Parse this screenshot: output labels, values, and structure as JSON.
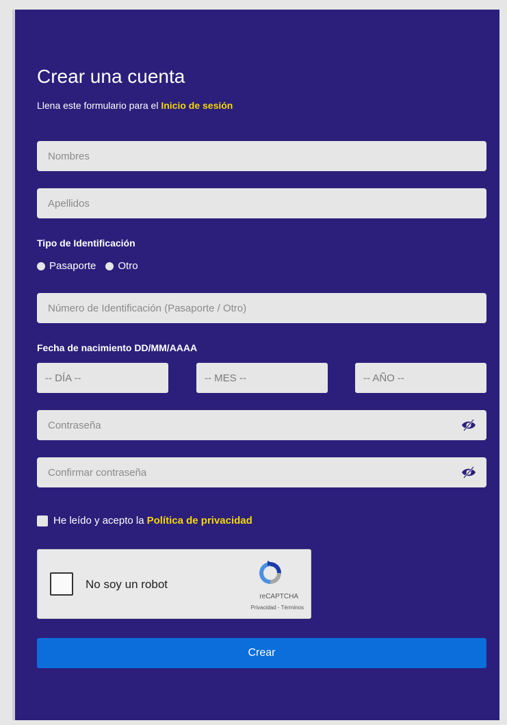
{
  "form": {
    "title": "Crear una cuenta",
    "subtitle_prefix": "Llena este formulario para el ",
    "subtitle_link": "Inicio de sesión",
    "first_name_placeholder": "Nombres",
    "last_name_placeholder": "Apellidos",
    "id_type_label": "Tipo de Identificación",
    "id_type_options": [
      "Pasaporte",
      "Otro"
    ],
    "id_number_placeholder": "Número de Identificación (Pasaporte / Otro)",
    "birthdate_label": "Fecha de nacimiento DD/MM/AAAA",
    "day_placeholder": "-- DÍA --",
    "month_placeholder": "-- MES --",
    "year_placeholder": "-- AÑO --",
    "password_placeholder": "Contraseña",
    "confirm_password_placeholder": "Confirmar contraseña",
    "privacy_prefix": "He leído y acepto la ",
    "privacy_link": "Política de privacidad",
    "submit_label": "Crear"
  },
  "captcha": {
    "label": "No soy un robot",
    "brand": "reCAPTCHA",
    "links": "Privacidad - Términos"
  },
  "colors": {
    "panel_bg": "#2b1f7b",
    "accent_yellow": "#f5d60a",
    "button_blue": "#0b6edb",
    "field_bg": "#e6e6e6"
  }
}
